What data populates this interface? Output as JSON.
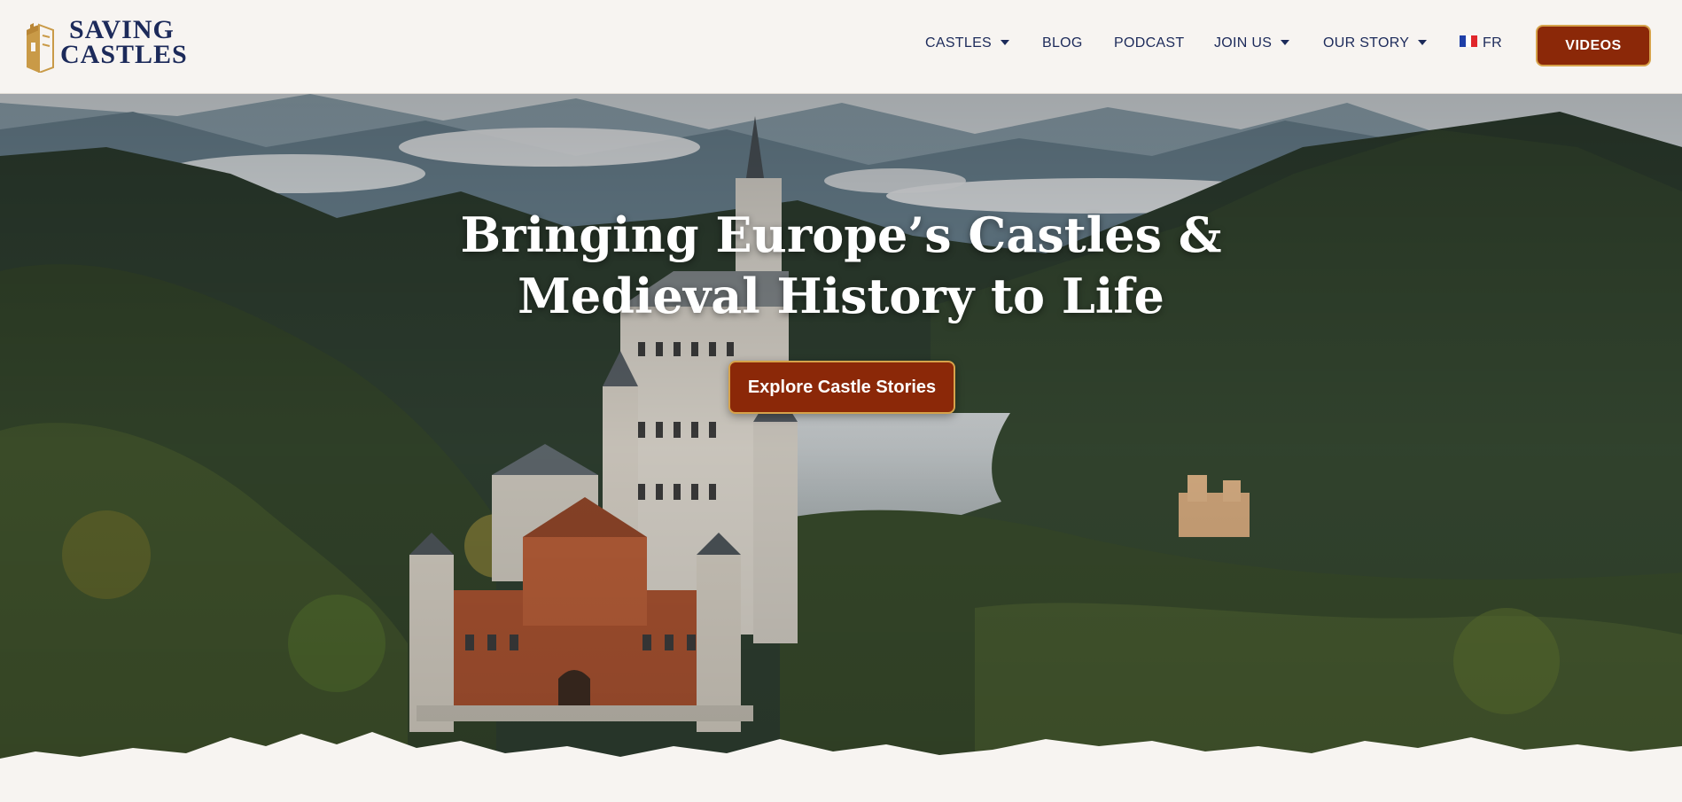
{
  "brand": {
    "logo_line1": "SAVING",
    "logo_line2": "CASTLES",
    "colors": {
      "navy": "#1c2a5a",
      "brick": "#8b2808",
      "gold": "#d6a24a",
      "paper": "#f7f4f1"
    }
  },
  "nav": {
    "items": [
      {
        "label": "CASTLES",
        "dropdown": true
      },
      {
        "label": "BLOG",
        "dropdown": false
      },
      {
        "label": "PODCAST",
        "dropdown": false
      },
      {
        "label": "JOIN US",
        "dropdown": true
      },
      {
        "label": "OUR STORY",
        "dropdown": true
      }
    ],
    "language": {
      "label": "FR",
      "flag_icon": "france-flag-icon"
    },
    "videos_button": "VIDEOS"
  },
  "hero": {
    "title_line1": "Bringing Europe’s Castles &",
    "title_line2": "Medieval History to Life",
    "cta_label": "Explore Castle Stories",
    "background": "neuschwanstein-castle-aerial-image"
  }
}
